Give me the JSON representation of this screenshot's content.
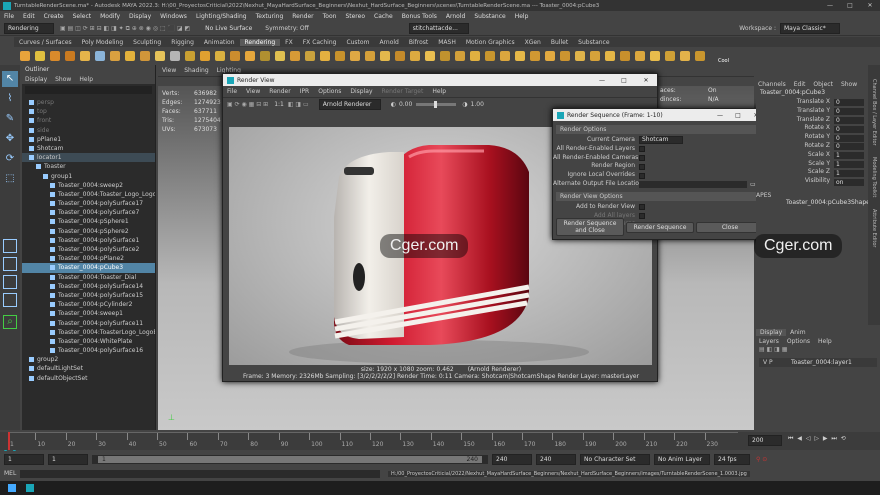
{
  "title_bar": {
    "app_title": "TurntableRenderScene.ma* - Autodesk MAYA 2022.3: H:\\00_ProyectosCriticial\\2022\\Nexhut_MayaHardSurface_Beginners\\Nexhut_HardSurface_Beginners\\scenes\\TurntableRenderScene.ma  ---  Toaster_0004:pCube3"
  },
  "menu": [
    "File",
    "Edit",
    "Create",
    "Select",
    "Modify",
    "Display",
    "Windows",
    "Lighting/Shading",
    "Texturing",
    "Render",
    "Toon",
    "Stereo",
    "Cache",
    "Bonus Tools",
    "Arnold",
    "Substance",
    "Help"
  ],
  "status": {
    "menuset": "Rendering",
    "live": "No Live Surface",
    "symmetry": "Symmetry: Off",
    "selected": "stitchattacde...",
    "workspace_label": "Workspace :",
    "workspace": "Maya Classic*"
  },
  "shelf_tabs": [
    "Curves / Surfaces",
    "Poly Modeling",
    "Sculpting",
    "Rigging",
    "Animation",
    "Rendering",
    "FX",
    "FX Caching",
    "Custom",
    "Arnold",
    "Bifrost",
    "MASH",
    "Motion Graphics",
    "XGen",
    "Bullet",
    "Substance"
  ],
  "shelf_cool": "Cool",
  "outliner": {
    "title": "Outliner",
    "menu": [
      "Display",
      "Show",
      "Help"
    ],
    "items": [
      {
        "label": "persp",
        "indent": 1,
        "dim": true
      },
      {
        "label": "top",
        "indent": 1,
        "dim": true
      },
      {
        "label": "front",
        "indent": 1,
        "dim": true
      },
      {
        "label": "side",
        "indent": 1,
        "dim": true
      },
      {
        "label": "pPlane1",
        "indent": 1
      },
      {
        "label": "Shotcam",
        "indent": 1
      },
      {
        "label": "locator1",
        "indent": 1,
        "hl": false,
        "grp": true
      },
      {
        "label": "Toaster",
        "indent": 2
      },
      {
        "label": "group1",
        "indent": 3
      },
      {
        "label": "Toaster_0004:sweep2",
        "indent": 4
      },
      {
        "label": "Toaster_0004:Toaster_Logo_Logotipo",
        "indent": 4
      },
      {
        "label": "Toaster_0004:polySurface17",
        "indent": 4
      },
      {
        "label": "Toaster_0004:polySurface7",
        "indent": 4
      },
      {
        "label": "Toaster_0004:pSphere1",
        "indent": 4
      },
      {
        "label": "Toaster_0004:pSphere2",
        "indent": 4
      },
      {
        "label": "Toaster_0004:polySurface1",
        "indent": 4
      },
      {
        "label": "Toaster_0004:polySurface2",
        "indent": 4
      },
      {
        "label": "Toaster_0004:pPlane2",
        "indent": 4
      },
      {
        "label": "Toaster_0004:pCube3",
        "indent": 4,
        "hl": true
      },
      {
        "label": "Toaster_0004:Toaster_Dial",
        "indent": 4
      },
      {
        "label": "Toaster_0004:polySurface14",
        "indent": 4
      },
      {
        "label": "Toaster_0004:polySurface15",
        "indent": 4
      },
      {
        "label": "Toaster_0004:pCylinder2",
        "indent": 4
      },
      {
        "label": "Toaster_0004:sweep1",
        "indent": 4
      },
      {
        "label": "Toaster_0004:polySurface11",
        "indent": 4
      },
      {
        "label": "Toaster_0004:ToasterLogo_LogoBordo",
        "indent": 4
      },
      {
        "label": "Toaster_0004:WhitePlate",
        "indent": 4
      },
      {
        "label": "Toaster_0004:polySurface16",
        "indent": 4
      },
      {
        "label": "group2",
        "indent": 1
      },
      {
        "label": "defaultLightSet",
        "indent": 1
      },
      {
        "label": "defaultObjectSet",
        "indent": 1
      }
    ]
  },
  "viewport": {
    "menu": [
      "View",
      "Shading",
      "Lighting"
    ],
    "stats_labels": [
      "Verts:",
      "Edges:",
      "Faces:",
      "Tris:",
      "UVs:"
    ],
    "stats_values": [
      "636982",
      "1274923",
      "637711",
      "1275404",
      "673073"
    ]
  },
  "render_view": {
    "title": "Render View",
    "menu": [
      "File",
      "View",
      "Render",
      "IPR",
      "Options",
      "Display",
      "Render Target",
      "Help"
    ],
    "renderer": "Arnold Renderer",
    "exposure": "0.00",
    "gamma": "1.00",
    "zoom_label": "1:1",
    "size_info": "size: 1920 x 1080  zoom: 0.462",
    "renderer_info": "(Arnold Renderer)",
    "frame_info": "Frame: 3    Memory: 2326Mb    Sampling: [3/2/2/2/2/2]    Render Time: 0:11    Camera: Shotcam|ShotcamShape    Render Layer: masterLayer"
  },
  "render_seq": {
    "title": "Render Sequence (Frame: 1-10)",
    "sec1": "Render Options",
    "rows": [
      {
        "label": "Current Camera",
        "value": "Shotcam",
        "type": "select"
      },
      {
        "label": "All Render-Enabled Layers",
        "type": "check"
      },
      {
        "label": "All Render-Enabled Cameras",
        "type": "check"
      },
      {
        "label": "Render Region",
        "type": "check"
      },
      {
        "label": "Ignore Local Overrides",
        "type": "check"
      },
      {
        "label": "Alternate Output File Location",
        "type": "field"
      }
    ],
    "sec2": "Render View Options",
    "rows2": [
      {
        "label": "Add to Render View",
        "dim": false
      },
      {
        "label": "Add All layers",
        "dim": true
      },
      {
        "label": "Add All Cameras",
        "dim": true
      }
    ],
    "buttons": [
      "Render Sequence and Close",
      "Render Sequence",
      "Close"
    ]
  },
  "channel_box": {
    "tabs": [
      "Channels",
      "Edit",
      "Object",
      "Show"
    ],
    "node": "Toaster_0004:pCube3",
    "attrs": [
      {
        "n": "Translate X",
        "v": "0"
      },
      {
        "n": "Translate Y",
        "v": "0"
      },
      {
        "n": "Translate Z",
        "v": "0"
      },
      {
        "n": "Rotate X",
        "v": "0"
      },
      {
        "n": "Rotate Y",
        "v": "0"
      },
      {
        "n": "Rotate Z",
        "v": "0"
      },
      {
        "n": "Scale X",
        "v": "1"
      },
      {
        "n": "Scale Y",
        "v": "1"
      },
      {
        "n": "Scale Z",
        "v": "1"
      },
      {
        "n": "Visibility",
        "v": "on"
      }
    ],
    "shapes_label": "APES",
    "shape": "Toaster_0004:pCube3Shape",
    "side_tabs": [
      "Channel Box / Layer Editor",
      "Modeling Toolkit",
      "Attribute Editor"
    ]
  },
  "hidden_partial": {
    "labels": [
      "aces:",
      "dinces:"
    ],
    "values": [
      "On",
      "N/A"
    ]
  },
  "layer_editor": {
    "tabs": [
      "Display",
      "Anim"
    ],
    "menu": [
      "Layers",
      "Options",
      "Help"
    ],
    "vp": "V   P",
    "layer": "Toaster_0004:layer1"
  },
  "timeline": {
    "ticks": [
      "1",
      "10",
      "20",
      "30",
      "40",
      "50",
      "60",
      "70",
      "80",
      "90",
      "100",
      "110",
      "120",
      "130",
      "140",
      "150",
      "160",
      "170",
      "180",
      "190",
      "200",
      "210",
      "220",
      "230"
    ],
    "end": "200",
    "current": "1"
  },
  "range": {
    "start": "1",
    "start2": "1",
    "range_start": "1",
    "range_end": "240",
    "end1": "240",
    "end2": "240",
    "char_set": "No Character Set",
    "anim_layer": "No Anim Layer",
    "fps": "24 fps"
  },
  "cmdline": {
    "label": "MEL",
    "path": "H:/00_ProyectosCriticial/2022/Nexhut_MayaHardSurface_Beginners/Nexhut_HardSurface_Beginners/images/TurntableRenderScene_1.0003.jpg"
  },
  "watermarks": [
    "Cger.com",
    "Cger.com"
  ],
  "colors": {
    "accent": "#5285a6",
    "toaster_red": "#c4162b"
  }
}
